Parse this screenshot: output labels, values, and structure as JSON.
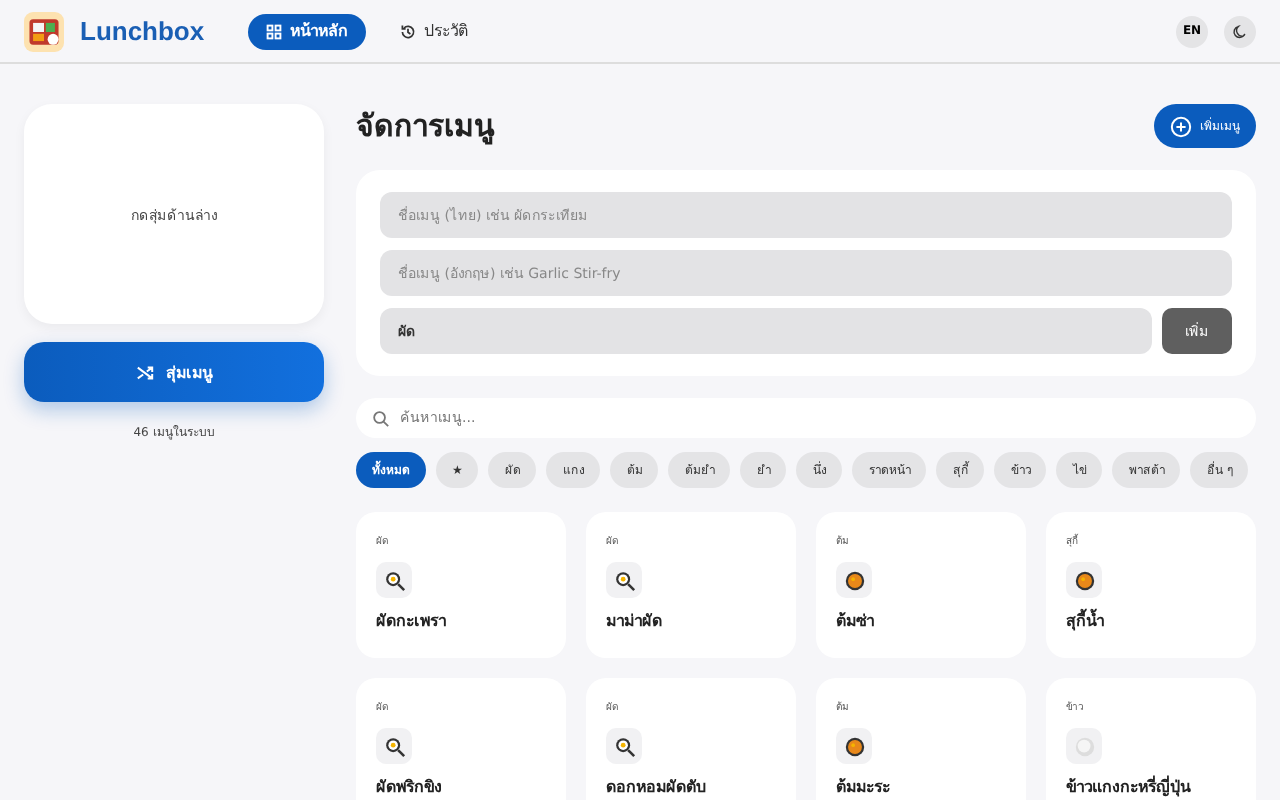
{
  "header": {
    "brand": "Lunchbox",
    "nav": [
      {
        "label": "หน้าหลัก",
        "kind": "grid",
        "selected": true
      },
      {
        "label": "ประวัติ",
        "kind": "history",
        "selected": false
      }
    ],
    "lang": "EN"
  },
  "random": {
    "prompt": "กดสุ่มด้านล่าง",
    "button": "สุ่มเมนู",
    "count": "46 เมนูในระบบ"
  },
  "main": {
    "title": "จัดการเมนู",
    "add_button": "เพิ่มเมนู"
  },
  "form": {
    "name_th": {
      "placeholder": "ชื่อเมนู (ไทย) เช่น ผัดกระเทียม"
    },
    "name_en": {
      "placeholder": "ชื่อเมนู (อังกฤษ) เช่น Garlic Stir-fry"
    },
    "category": {
      "value": "ผัด"
    },
    "submit": "เพิ่ม"
  },
  "search": {
    "placeholder": "ค้นหาเมนู..."
  },
  "filters": [
    {
      "label": "ทั้งหมด",
      "selected": true
    },
    {
      "label": "★",
      "selected": false
    },
    {
      "label": "ผัด",
      "selected": false
    },
    {
      "label": "แกง",
      "selected": false
    },
    {
      "label": "ต้ม",
      "selected": false
    },
    {
      "label": "ต้มยำ",
      "selected": false
    },
    {
      "label": "ยำ",
      "selected": false
    },
    {
      "label": "นึ่ง",
      "selected": false
    },
    {
      "label": "ราดหน้า",
      "selected": false
    },
    {
      "label": "สุกี้",
      "selected": false
    },
    {
      "label": "ข้าว",
      "selected": false
    },
    {
      "label": "ไข่",
      "selected": false
    },
    {
      "label": "พาสต้า",
      "selected": false
    },
    {
      "label": "อื่น ๆ",
      "selected": false
    }
  ],
  "menus": [
    {
      "category": "ผัด",
      "name": "ผัดกะเพรา",
      "kind": "pan"
    },
    {
      "category": "ผัด",
      "name": "มาม่าผัด",
      "kind": "pan"
    },
    {
      "category": "ต้ม",
      "name": "ต้มซ่า",
      "kind": "pot"
    },
    {
      "category": "สุกี้",
      "name": "สุกี้น้ำ",
      "kind": "pot"
    },
    {
      "category": "ผัด",
      "name": "ผัดพริกขิง",
      "kind": "pan"
    },
    {
      "category": "ผัด",
      "name": "ดอกหอมผัดตับ",
      "kind": "pan"
    },
    {
      "category": "ต้ม",
      "name": "ต้มมะระ",
      "kind": "pot"
    },
    {
      "category": "ข้าว",
      "name": "ข้าวแกงกะหรี่ญี่ปุ่น",
      "kind": "rice"
    }
  ]
}
